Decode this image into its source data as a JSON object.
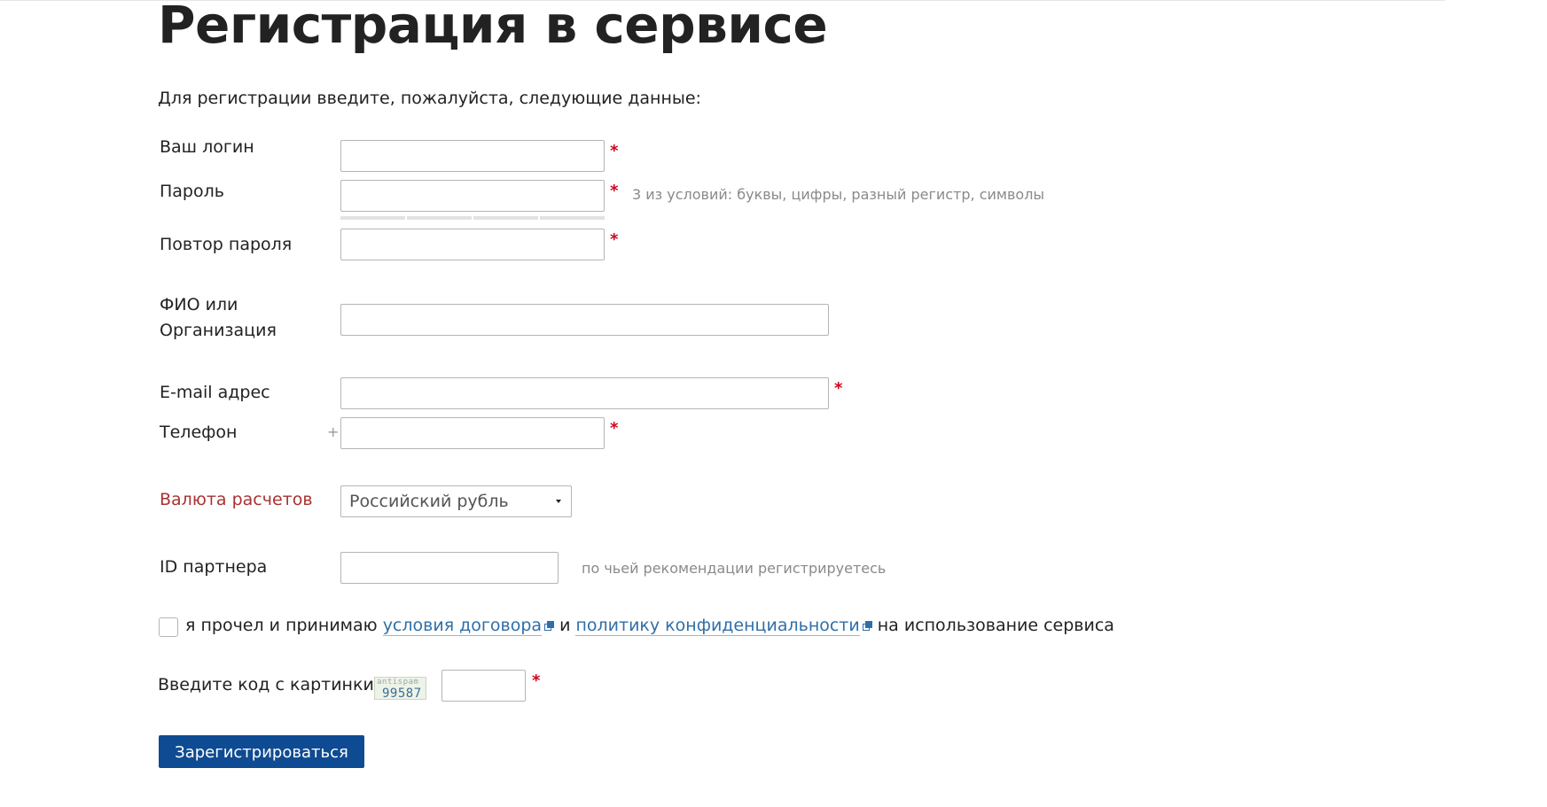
{
  "page": {
    "title": "Регистрация в сервисе",
    "intro": "Для регистрации введите, пожалуйста, следующие данные:"
  },
  "form": {
    "login": {
      "label": "Ваш логин",
      "value": "",
      "required_mark": "*"
    },
    "password": {
      "label": "Пароль",
      "value": "",
      "required_mark": "*",
      "hint": "3 из условий: буквы, цифры, разный регистр, символы"
    },
    "password_repeat": {
      "label": "Повтор пароля",
      "value": "",
      "required_mark": "*"
    },
    "fio": {
      "label_line1": "ФИО или",
      "label_line2": "Организация",
      "value": ""
    },
    "email": {
      "label": "E-mail адрес",
      "value": "",
      "required_mark": "*"
    },
    "phone": {
      "label": "Телефон",
      "prefix": "+",
      "value": "",
      "required_mark": "*"
    },
    "currency": {
      "label": "Валюта расчетов",
      "selected": "Российский рубль",
      "label_color": "#a83232"
    },
    "partner": {
      "label": "ID партнера",
      "value": "",
      "hint": "по чьей рекомендации регистрируетесь"
    },
    "agreement": {
      "checked": false,
      "text_before": "я прочел и принимаю",
      "link1": "условия договора",
      "text_middle": "и",
      "link2": "политику конфиденциальности",
      "text_after": "на использование сервиса"
    },
    "captcha": {
      "label": "Введите код с картинки",
      "image_top_text": "antispam",
      "image_code": "99587",
      "value": "",
      "required_mark": "*"
    },
    "submit_label": "Зарегистрироваться"
  },
  "colors": {
    "accent_button": "#0f4b92",
    "link": "#2f6fa8",
    "required": "#d0021b"
  }
}
